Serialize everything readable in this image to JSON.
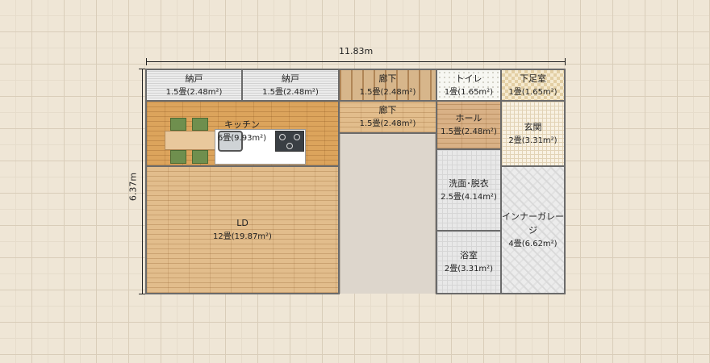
{
  "dimensions": {
    "width": "11.83m",
    "height": "6.37m"
  },
  "rooms": {
    "nando1": {
      "name": "納戸",
      "size": "1.5畳(2.48m²)"
    },
    "nando2": {
      "name": "納戸",
      "size": "1.5畳(2.48m²)"
    },
    "rouka1": {
      "name": "廊下",
      "size": "1.5畳(2.48m²)"
    },
    "toilet": {
      "name": "トイレ",
      "size": "1畳(1.65m²)"
    },
    "shitasoku": {
      "name": "下足室",
      "size": "1畳(1.65m²)"
    },
    "kitchen": {
      "name": "キッチン",
      "size": "6畳(9.93m²)"
    },
    "rouka2": {
      "name": "廊下",
      "size": "1.5畳(2.48m²)"
    },
    "hall": {
      "name": "ホール",
      "size": "1.5畳(2.48m²)"
    },
    "genkan": {
      "name": "玄関",
      "size": "2畳(3.31m²)"
    },
    "senmen": {
      "name": "洗面･脱衣",
      "size": "2.5畳(4.14m²)"
    },
    "garage": {
      "name": "インナーガレージ",
      "size": "4畳(6.62m²)"
    },
    "ld": {
      "name": "LD",
      "size": "12畳(19.87m²)"
    },
    "yokushitsu": {
      "name": "浴室",
      "size": "2畳(3.31m²)"
    }
  }
}
